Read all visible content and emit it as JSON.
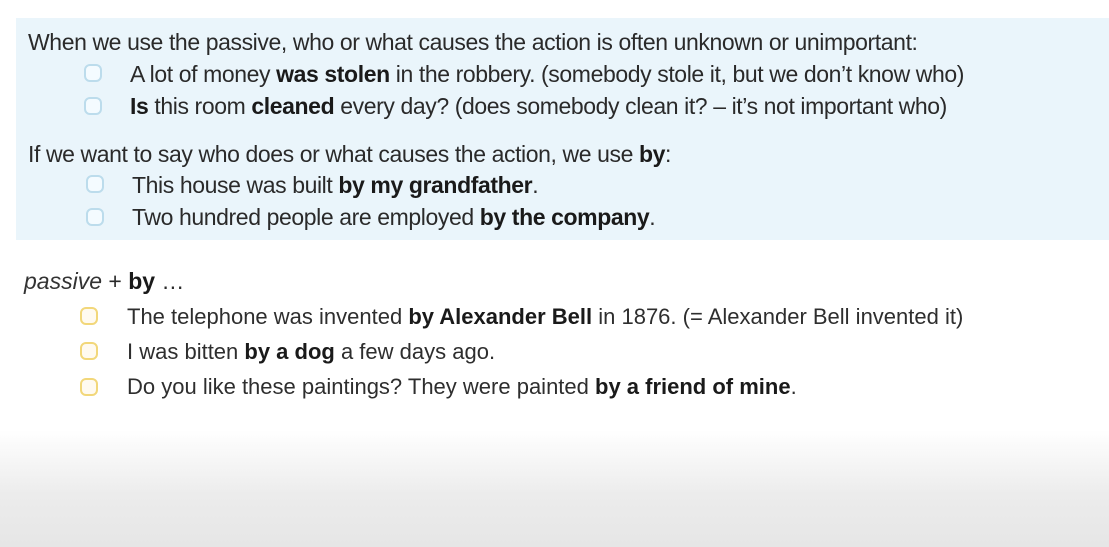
{
  "section1": {
    "intro": "When we use the passive, who or what causes the action is often unknown or unimportant:",
    "examples": [
      {
        "pre": "",
        "bold1": "",
        "mid": "A lot of money ",
        "bold2": "was stolen",
        "post": " in the robbery.  (somebody stole it, but we don’t know who)"
      },
      {
        "pre": "",
        "bold1": "Is",
        "mid": " this room ",
        "bold2": "cleaned",
        "post": " every day?  (does somebody clean it? – it’s not important who)"
      }
    ]
  },
  "section2": {
    "intro_text": "If we want to say who does or what causes the action, we use ",
    "intro_bold": "by",
    "intro_end": ":",
    "examples": [
      {
        "text": "This house was built ",
        "bold": "by my grandfather",
        "end": "."
      },
      {
        "text": "Two hundred people are employed ",
        "bold": "by the company",
        "end": "."
      }
    ]
  },
  "section3": {
    "heading_italic": "passive",
    "heading_plus": " + ",
    "heading_bold": "by",
    "heading_end": " …",
    "examples": [
      {
        "text": "The telephone was invented ",
        "bold": "by Alexander Bell",
        "end": " in 1876.  (= Alexander Bell invented it)"
      },
      {
        "text": "I was bitten ",
        "bold": "by a dog",
        "end": " a few days ago."
      },
      {
        "text": "Do you like these paintings?  They were painted ",
        "bold": "by a friend of mine",
        "end": "."
      }
    ]
  },
  "colors": {
    "box_background": "#eaf5fb",
    "blue_bullet": "#bcdcec",
    "yellow_bullet": "#f2d77a",
    "text": "#2a2a2a"
  }
}
